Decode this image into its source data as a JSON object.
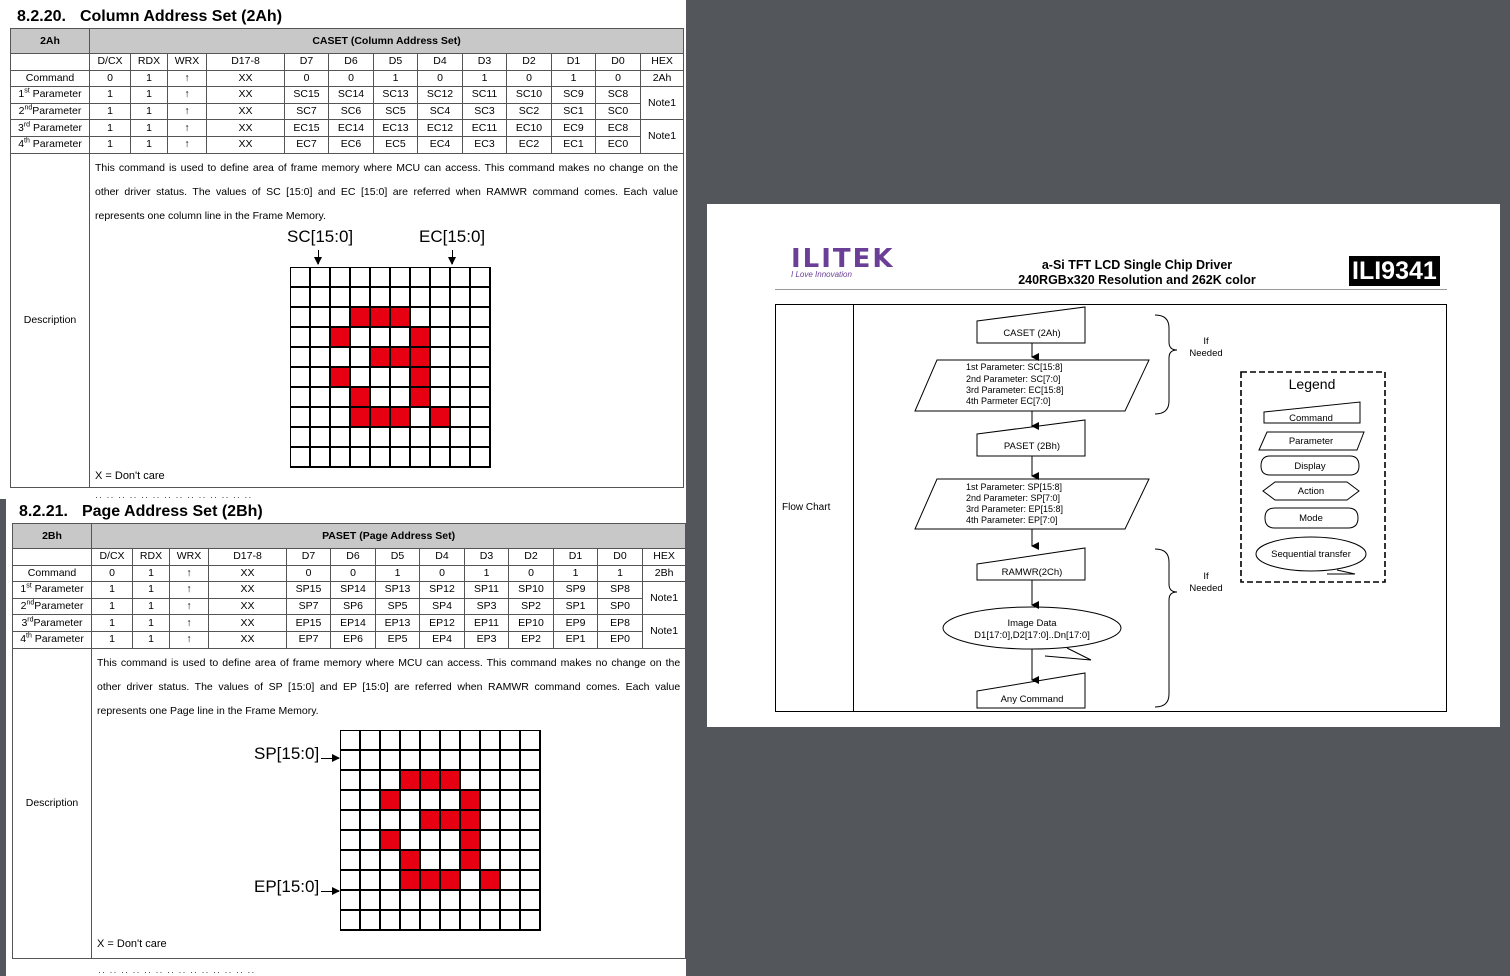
{
  "caset": {
    "section_num": "8.2.20.",
    "section_title": "Column Address Set (2Ah)",
    "code": "2Ah",
    "name": "CASET (Column Address Set)",
    "columns": [
      "D/CX",
      "RDX",
      "WRX",
      "D17-8",
      "D7",
      "D6",
      "D5",
      "D4",
      "D3",
      "D2",
      "D1",
      "D0",
      "HEX"
    ],
    "rows": [
      {
        "label": "Command",
        "sup": "",
        "suffix": "",
        "cells": [
          "0",
          "1",
          "↑",
          "XX",
          "0",
          "0",
          "1",
          "0",
          "1",
          "0",
          "1",
          "0"
        ],
        "hex": "2Ah"
      },
      {
        "label": "1",
        "sup": "st",
        "suffix": " Parameter",
        "cells": [
          "1",
          "1",
          "↑",
          "XX",
          "SC15",
          "SC14",
          "SC13",
          "SC12",
          "SC11",
          "SC10",
          "SC9",
          "SC8"
        ],
        "hex": "Note1"
      },
      {
        "label": "2",
        "sup": "nd",
        "suffix": "Parameter",
        "cells": [
          "1",
          "1",
          "↑",
          "XX",
          "SC7",
          "SC6",
          "SC5",
          "SC4",
          "SC3",
          "SC2",
          "SC1",
          "SC0"
        ],
        "hex": ""
      },
      {
        "label": "3",
        "sup": "rd",
        "suffix": " Parameter",
        "cells": [
          "1",
          "1",
          "↑",
          "XX",
          "EC15",
          "EC14",
          "EC13",
          "EC12",
          "EC11",
          "EC10",
          "EC9",
          "EC8"
        ],
        "hex": "Note1"
      },
      {
        "label": "4",
        "sup": "th",
        "suffix": " Parameter",
        "cells": [
          "1",
          "1",
          "↑",
          "XX",
          "EC7",
          "EC6",
          "EC5",
          "EC4",
          "EC3",
          "EC2",
          "EC1",
          "EC0"
        ],
        "hex": ""
      }
    ],
    "desc_label": "Description",
    "desc_text": "This command is used to define area of frame memory where MCU can access. This command makes no change on the other driver status. The values of SC [15:0] and EC [15:0] are referred when RAMWR command comes. Each value represents one column line in the Frame Memory.",
    "label_a": "SC[15:0]",
    "label_b": "EC[15:0]",
    "dont_care": "X = Don't care",
    "grid_on": [
      [
        2,
        3
      ],
      [
        2,
        4
      ],
      [
        2,
        5
      ],
      [
        3,
        2
      ],
      [
        3,
        6
      ],
      [
        4,
        4
      ],
      [
        4,
        5
      ],
      [
        4,
        6
      ],
      [
        5,
        2
      ],
      [
        5,
        6
      ],
      [
        6,
        3
      ],
      [
        6,
        6
      ],
      [
        7,
        3
      ],
      [
        7,
        4
      ],
      [
        7,
        5
      ],
      [
        7,
        7
      ]
    ]
  },
  "paset": {
    "section_num": "8.2.21.",
    "section_title": "Page Address Set (2Bh)",
    "code": "2Bh",
    "name": "PASET (Page Address Set)",
    "columns": [
      "D/CX",
      "RDX",
      "WRX",
      "D17-8",
      "D7",
      "D6",
      "D5",
      "D4",
      "D3",
      "D2",
      "D1",
      "D0",
      "HEX"
    ],
    "rows": [
      {
        "label": "Command",
        "sup": "",
        "suffix": "",
        "cells": [
          "0",
          "1",
          "↑",
          "XX",
          "0",
          "0",
          "1",
          "0",
          "1",
          "0",
          "1",
          "1"
        ],
        "hex": "2Bh"
      },
      {
        "label": "1",
        "sup": "st",
        "suffix": " Parameter",
        "cells": [
          "1",
          "1",
          "↑",
          "XX",
          "SP15",
          "SP14",
          "SP13",
          "SP12",
          "SP11",
          "SP10",
          "SP9",
          "SP8"
        ],
        "hex": "Note1"
      },
      {
        "label": "2",
        "sup": "nd",
        "suffix": "Parameter",
        "cells": [
          "1",
          "1",
          "↑",
          "XX",
          "SP7",
          "SP6",
          "SP5",
          "SP4",
          "SP3",
          "SP2",
          "SP1",
          "SP0"
        ],
        "hex": ""
      },
      {
        "label": "3",
        "sup": "rd",
        "suffix": "Parameter",
        "cells": [
          "1",
          "1",
          "↑",
          "XX",
          "EP15",
          "EP14",
          "EP13",
          "EP12",
          "EP11",
          "EP10",
          "EP9",
          "EP8"
        ],
        "hex": "Note1"
      },
      {
        "label": "4",
        "sup": "th",
        "suffix": " Parameter",
        "cells": [
          "1",
          "1",
          "↑",
          "XX",
          "EP7",
          "EP6",
          "EP5",
          "EP4",
          "EP3",
          "EP2",
          "EP1",
          "EP0"
        ],
        "hex": ""
      }
    ],
    "desc_label": "Description",
    "desc_text": "This command is used to define area of frame memory where MCU can access. This command makes no change on the other driver status. The values of SP [15:0] and EP [15:0] are referred when RAMWR command comes. Each value represents one Page line in the Frame Memory.",
    "label_a": "SP[15:0]",
    "label_b": "EP[15:0]",
    "dont_care": "X = Don't care",
    "grid_on": [
      [
        2,
        3
      ],
      [
        2,
        4
      ],
      [
        2,
        5
      ],
      [
        3,
        2
      ],
      [
        3,
        6
      ],
      [
        4,
        4
      ],
      [
        4,
        5
      ],
      [
        4,
        6
      ],
      [
        5,
        2
      ],
      [
        5,
        6
      ],
      [
        6,
        3
      ],
      [
        6,
        6
      ],
      [
        7,
        3
      ],
      [
        7,
        4
      ],
      [
        7,
        5
      ],
      [
        7,
        7
      ]
    ]
  },
  "flow": {
    "logo": "ILITEK",
    "tagline": "I Love Innovation",
    "title_line1": "a-Si TFT LCD Single Chip Driver",
    "title_line2": "240RGBx320 Resolution and 262K color",
    "chip": "ILI9341",
    "row_label": "Flow Chart",
    "caset": "CASET (2Ah)",
    "caset_params": [
      "1st Parameter: SC[15:8]",
      "2nd Parameter: SC[7:0]",
      "3rd Parameter: EC[15:8]",
      "4th Parmeter EC[7:0]"
    ],
    "paset": "PASET (2Bh)",
    "paset_params": [
      "1st Parameter: SP[15:8]",
      "2nd Parameter: SP[7:0]",
      "3rd Parameter: EP[15:8]",
      "4th Parameter: EP[7:0]"
    ],
    "ramwr": "RAMWR(2Ch)",
    "image_data_1": "Image Data",
    "image_data_2": "D1[17:0],D2[17:0]..Dn[17:0]",
    "any_command": "Any Command",
    "if_1": "If",
    "if_2": "Needed",
    "legend_title": "Legend",
    "legend_items": [
      "Command",
      "Parameter",
      "Display",
      "Action",
      "Mode",
      "Sequential transfer"
    ]
  }
}
